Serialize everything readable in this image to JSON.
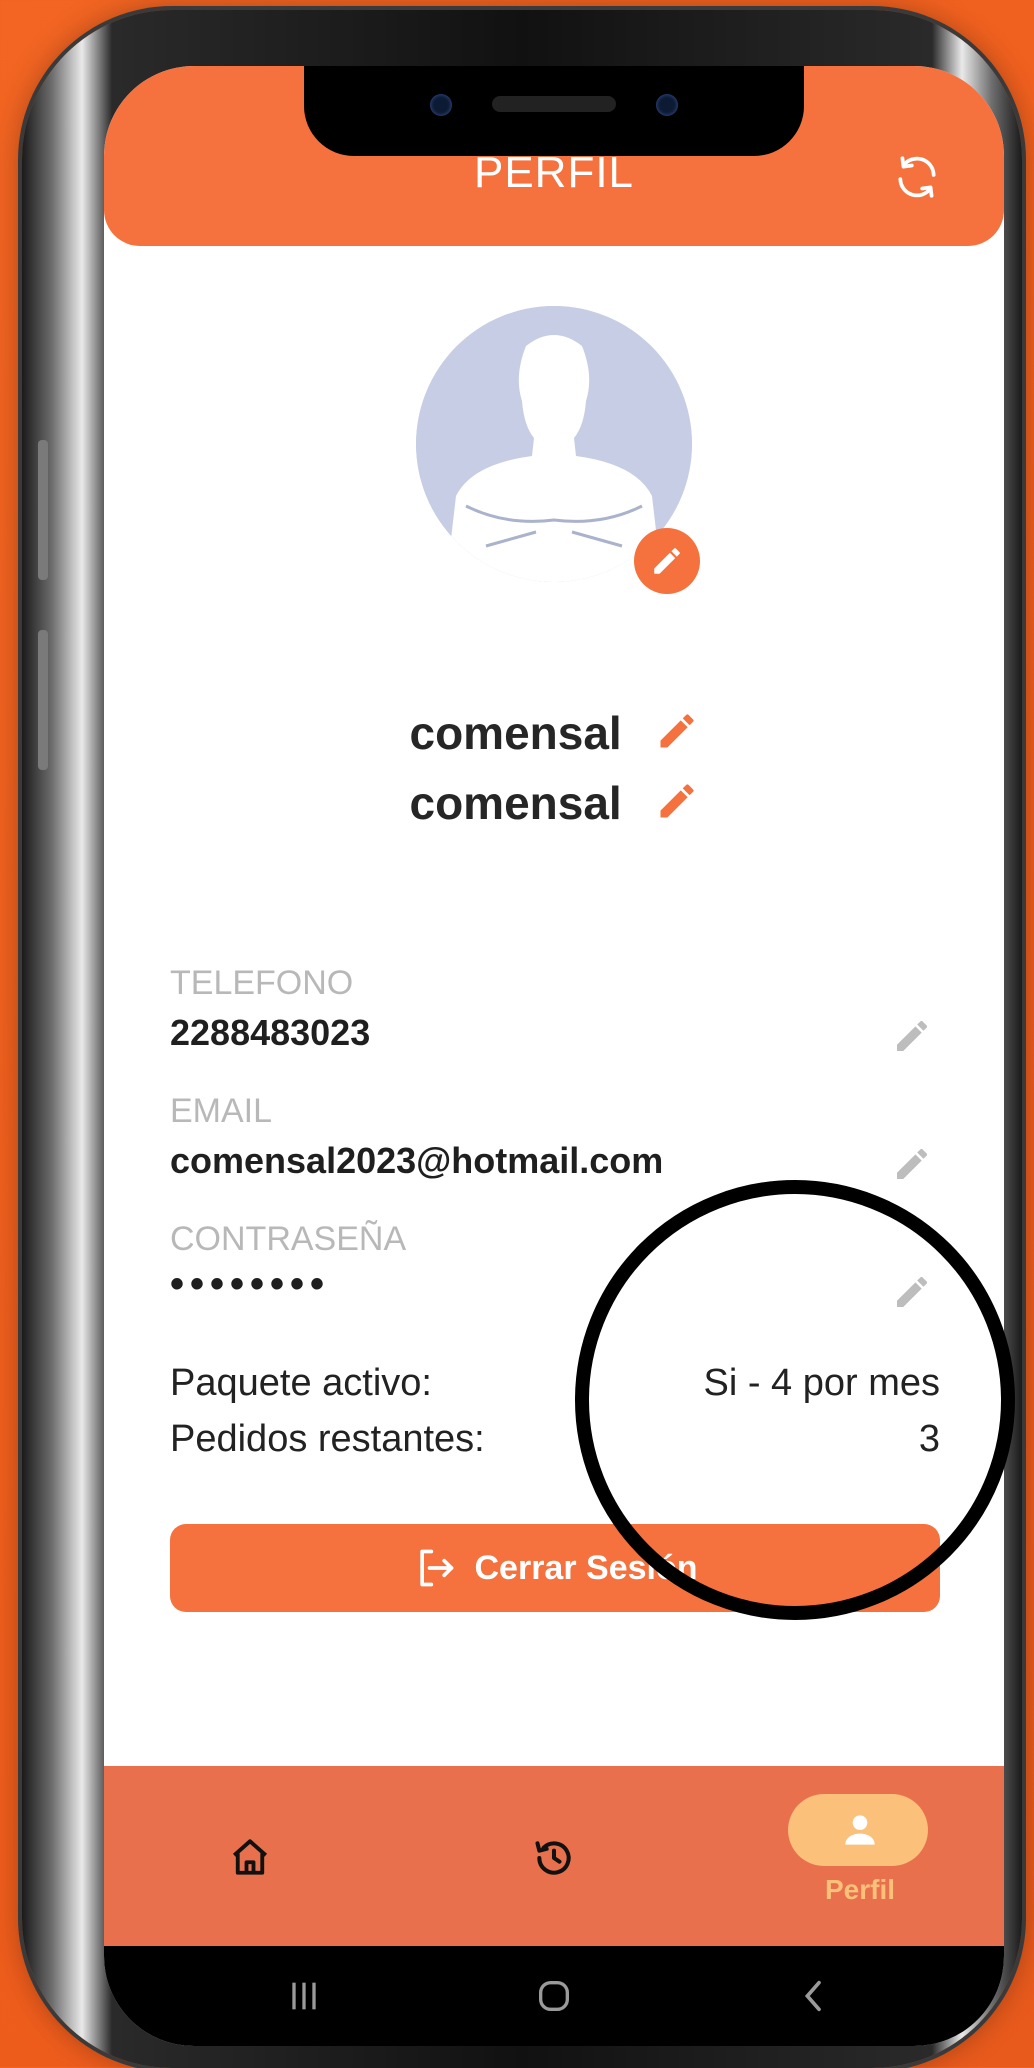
{
  "header": {
    "title": "PERFIL",
    "refresh_icon": "refresh-icon"
  },
  "profile": {
    "first_name": "comensal",
    "last_name": "comensal"
  },
  "fields": [
    {
      "label": "TELEFONO",
      "value": "2288483023"
    },
    {
      "label": "EMAIL",
      "value": "comensal2023@hotmail.com"
    },
    {
      "label": "CONTRASEÑA",
      "value": "••••••••"
    }
  ],
  "package": {
    "active_label": "Paquete activo:",
    "active_value": "Si - 4 por mes",
    "remaining_label": "Pedidos restantes:",
    "remaining_value": "3"
  },
  "logout_button": {
    "label": "Cerrar Sesión"
  },
  "bottom_nav": {
    "items": [
      {
        "icon": "home-icon"
      },
      {
        "icon": "history-icon"
      },
      {
        "icon": "person-icon",
        "label": "Perfil",
        "active": true
      }
    ]
  },
  "colors": {
    "accent": "#f5713d",
    "nav_bg": "#e8704c",
    "active_pill": "#fbc07a"
  }
}
